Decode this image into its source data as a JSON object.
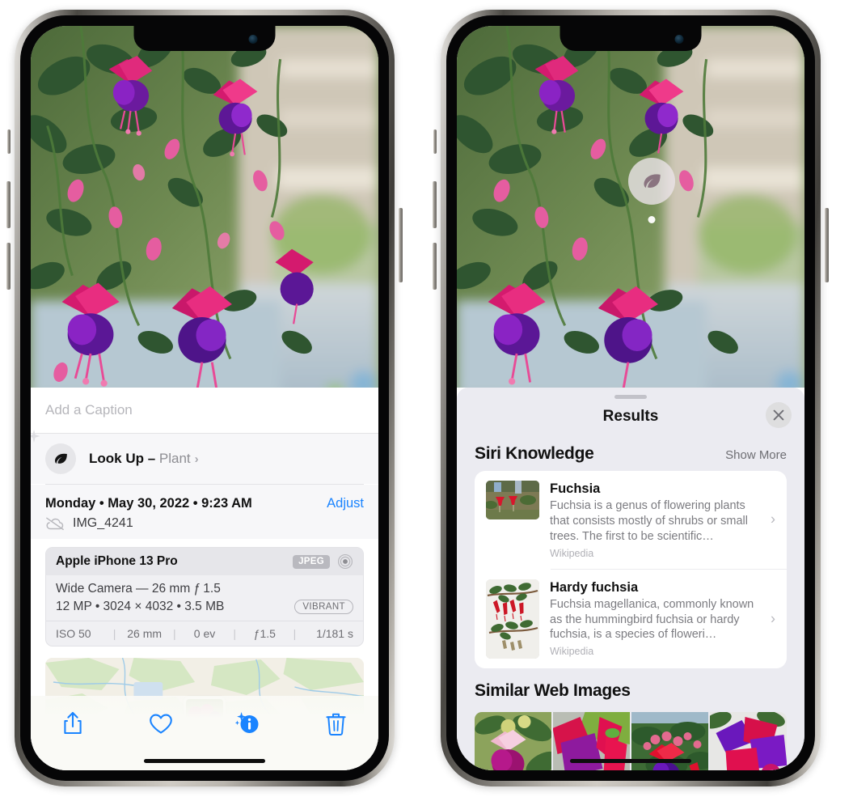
{
  "accent": "#1a84ff",
  "left_phone": {
    "name": "photos-detail-screen",
    "caption": {
      "placeholder": "Add a Caption",
      "value": ""
    },
    "lookup": {
      "label": "Look Up",
      "dash": " – ",
      "subject": "Plant",
      "chevron": "›",
      "icon": "leaf-icon"
    },
    "meta": {
      "date": "Monday • May 30, 2022 • 9:23 AM",
      "adjust": "Adjust",
      "filename": "IMG_4241",
      "cloud_icon": "icloud-slash-icon"
    },
    "camera": {
      "model": "Apple iPhone 13 Pro",
      "format_badge": "JPEG",
      "lens_icon": "aperture-icon",
      "lens": "Wide Camera — 26 mm ƒ 1.5",
      "spec": "12 MP • 3024 × 4032 • 3.5 MB",
      "style_badge": "VIBRANT",
      "exif": [
        "ISO 50",
        "26 mm",
        "0 ev",
        "ƒ1.5",
        "1/181 s"
      ]
    },
    "map": {
      "name": "location-map-thumbnail"
    },
    "toolbar": [
      {
        "name": "share-button",
        "icon": "share-icon"
      },
      {
        "name": "favorite-button",
        "icon": "heart-icon"
      },
      {
        "name": "info-button",
        "icon": "info-sparkle-icon"
      },
      {
        "name": "delete-button",
        "icon": "trash-icon"
      }
    ]
  },
  "right_phone": {
    "name": "visual-lookup-results-screen",
    "photo_badge": {
      "icon": "leaf-icon",
      "name": "visual-lookup-badge"
    },
    "panel": {
      "title": "Results",
      "close_label": "✕",
      "sections": [
        {
          "title": "Siri Knowledge",
          "action": "Show More",
          "items": [
            {
              "name": "Fuchsia",
              "desc": "Fuchsia is a genus of flowering plants that consists mostly of shrubs or small trees. The first to be scientific…",
              "source": "Wikipedia",
              "thumb": "fuchsia-thumb"
            },
            {
              "name": "Hardy fuchsia",
              "desc": "Fuchsia magellanica, commonly known as the hummingbird fuchsia or hardy fuchsia, is a species of floweri…",
              "source": "Wikipedia",
              "thumb": "hardy-fuchsia-thumb"
            }
          ]
        },
        {
          "title": "Similar Web Images",
          "action": "",
          "tiles": [
            "web-image-1",
            "web-image-2",
            "web-image-3",
            "web-image-4"
          ]
        }
      ]
    }
  }
}
